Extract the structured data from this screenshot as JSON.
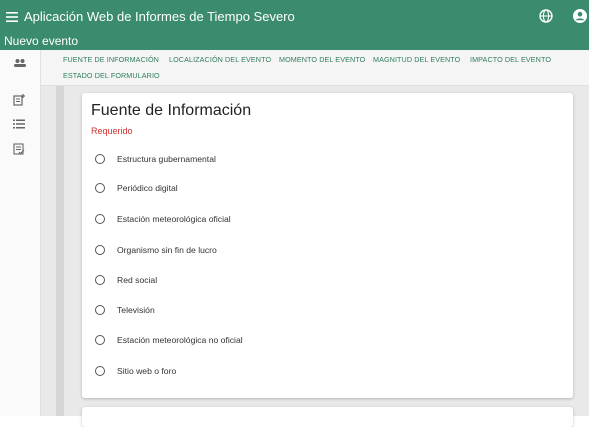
{
  "app": {
    "title": "Aplicación Web de Informes de Tiempo Severo"
  },
  "subheader": {
    "title": "Nuevo evento"
  },
  "tabs": [
    "FUENTE DE INFORMACIÓN",
    "LOCALIZACIÓN DEL EVENTO",
    "MOMENTO DEL EVENTO",
    "MAGNITUD DEL EVENTO",
    "IMPACTO DEL EVENTO",
    "ESTADO DEL FORMULARIO"
  ],
  "section": {
    "title": "Fuente de Información",
    "required": "Requerido",
    "options": [
      "Estructura gubernamental",
      "Periódico digital",
      "Estación meteorológica oficial",
      "Organismo sin fin de lucro",
      "Red social",
      "Televisión",
      "Estación meteorológica no oficial",
      "Sitio web o foro"
    ]
  },
  "colors": {
    "primary": "#3b8c6e",
    "tab_text": "#2e7d5b",
    "required": "#d32f2f"
  },
  "icons": {
    "menu": "menu-icon",
    "globe": "globe-icon",
    "account": "account-icon",
    "sidebar": [
      "group-icon",
      "add-note-icon",
      "list-icon",
      "checklist-icon"
    ]
  }
}
